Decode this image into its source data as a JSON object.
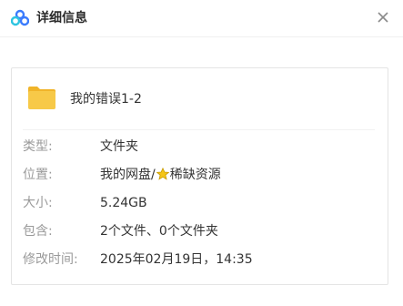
{
  "header": {
    "title": "详细信息",
    "logo_icon": "cloud-logo-icon",
    "close_icon": "close-icon"
  },
  "file": {
    "icon": "folder-icon",
    "name": "我的错误1-2"
  },
  "details": {
    "type": {
      "label": "类型:",
      "value": "文件夹"
    },
    "location": {
      "label": "位置:",
      "value_prefix": "我的网盘/",
      "star_icon": "star-icon",
      "value_suffix": "稀缺资源"
    },
    "size": {
      "label": "大小:",
      "value": "5.24GB"
    },
    "contains": {
      "label": "包含:",
      "value": "2个文件、0个文件夹"
    },
    "modified": {
      "label": "修改时间:",
      "value": "2025年02月19日，14:35"
    }
  },
  "colors": {
    "folder": "#f7c948",
    "accent_blue": "#3a7bfd",
    "accent_cyan": "#2ec4e0",
    "star": "#f5c518"
  }
}
